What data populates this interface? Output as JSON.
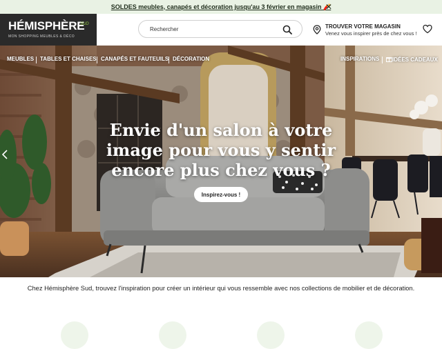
{
  "promo": {
    "text": "SOLDES meubles, canapés et décoration jusqu'au 3 février en magasin 🧨"
  },
  "logo": {
    "brand_main": "HÉMISPHÈRE",
    "brand_sub": "SUD",
    "tagline": "MON SHOPPING MEUBLES & DÉCO"
  },
  "search": {
    "placeholder": "Rechercher"
  },
  "store": {
    "title": "TROUVER VOTRE MAGASIN",
    "subtitle": "Venez vous inspirer près de chez vous !"
  },
  "nav": {
    "items": [
      "MEUBLES",
      "TABLES ET CHAISES",
      "CANAPÉS ET FAUTEUILS",
      "DÉCORATION"
    ],
    "right_items": [
      "INSPIRATIONS",
      "IDÉES CADEAUX"
    ]
  },
  "hero": {
    "headline": "Envie d'un salon à votre image pour vous y sentir encore plus chez vous ?",
    "cta": "Inspirez-vous !"
  },
  "intro": {
    "text": "Chez Hémisphère Sud, trouvez l'inspiration pour créer un intérieur qui vous ressemble avec nos collections de mobilier et de décoration."
  },
  "colors": {
    "accent_green": "#8fc441",
    "promo_bg": "#e9f2e4",
    "logo_bg": "#2a2a2a"
  }
}
